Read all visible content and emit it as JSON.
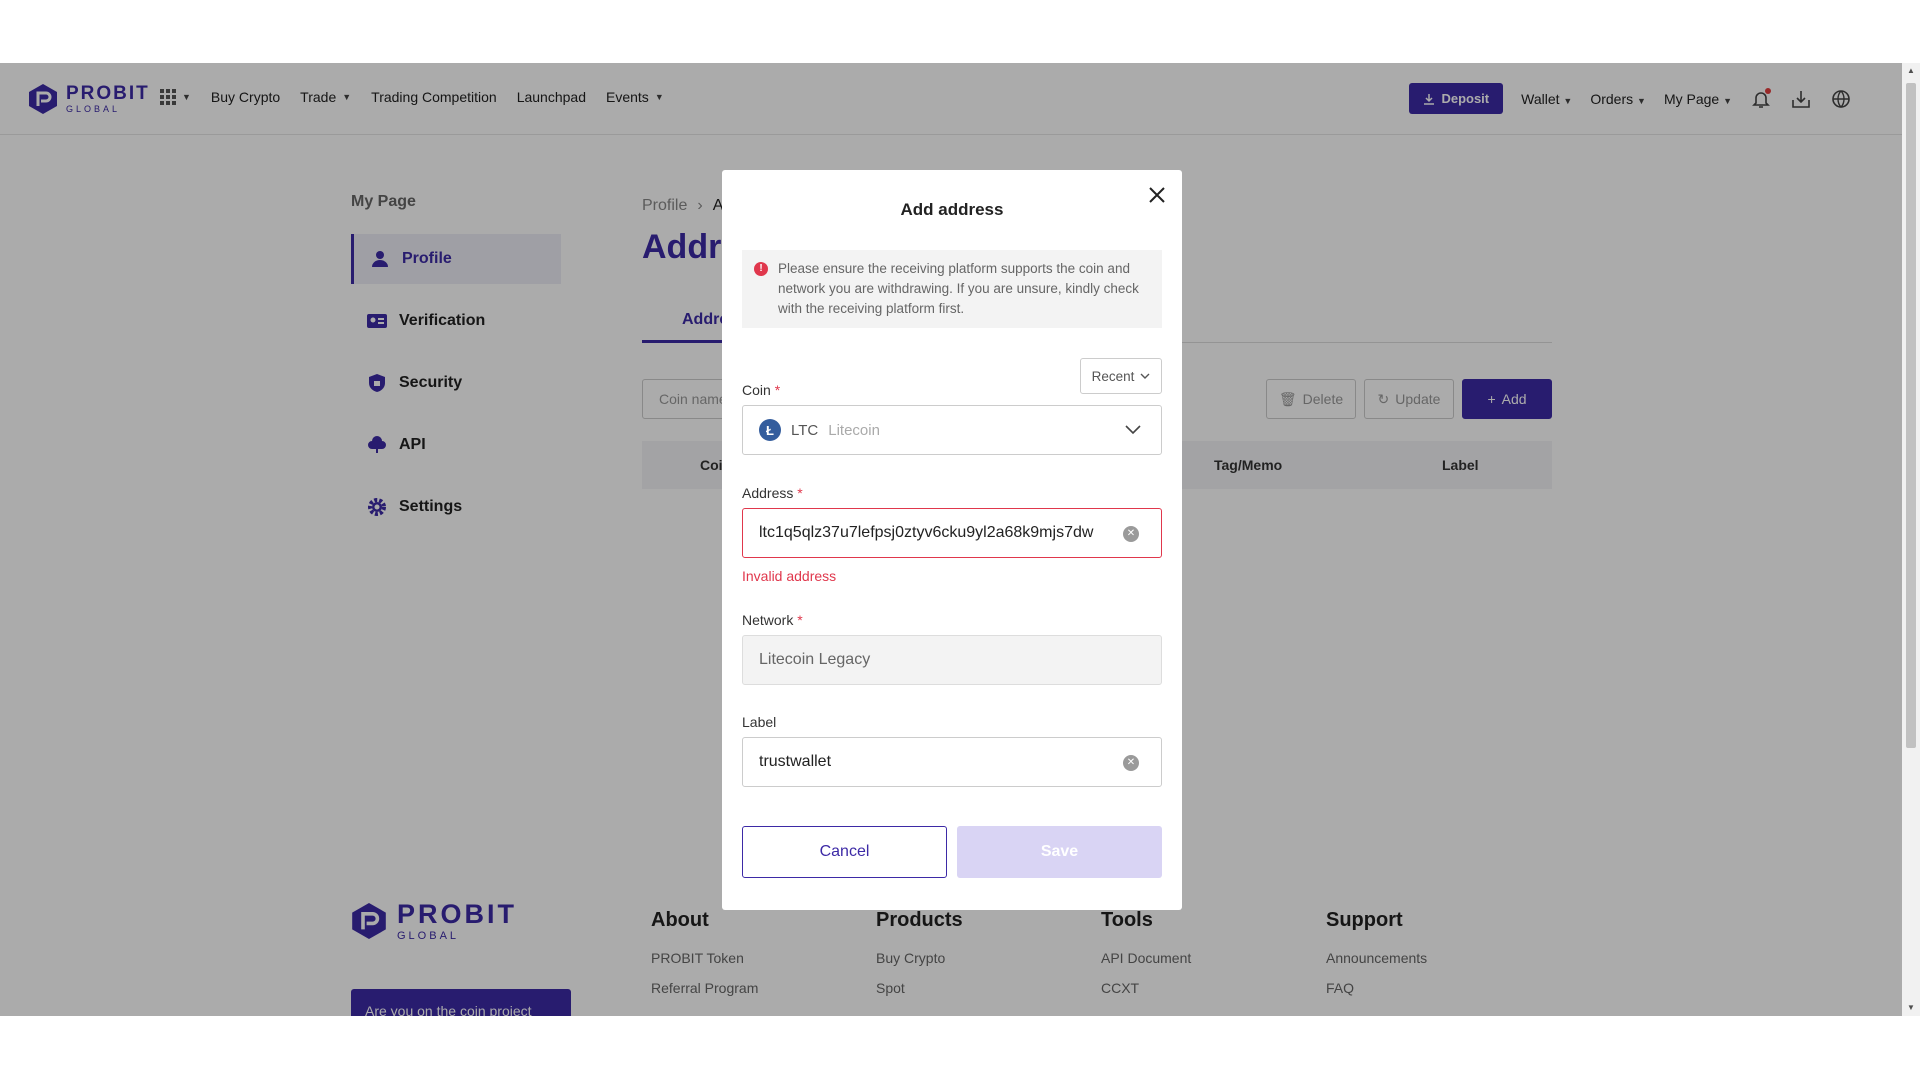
{
  "header": {
    "brand": "PROBIT",
    "brand_sub": "GLOBAL",
    "nav": [
      "Buy Crypto",
      "Trade",
      "Trading Competition",
      "Launchpad",
      "Events"
    ],
    "deposit_label": "Deposit",
    "right_nav": [
      "Wallet",
      "Orders",
      "My Page"
    ]
  },
  "sidebar": {
    "title": "My Page",
    "items": [
      {
        "label": "Profile",
        "icon": "user-icon"
      },
      {
        "label": "Verification",
        "icon": "id-card-icon"
      },
      {
        "label": "Security",
        "icon": "shield-icon"
      },
      {
        "label": "API",
        "icon": "cloud-icon"
      },
      {
        "label": "Settings",
        "icon": "gear-icon"
      }
    ]
  },
  "main": {
    "breadcrumb": [
      "Profile",
      "A"
    ],
    "title": "Addre",
    "tab_label": "Addre",
    "filter_placeholder": "Coin name",
    "actions": {
      "delete": "Delete",
      "update": "Update",
      "add": "Add"
    },
    "columns": [
      "Coi",
      "Tag/Memo",
      "Label"
    ]
  },
  "footer": {
    "brand": "PROBIT",
    "brand_sub": "GLOBAL",
    "cta": "Are you on the coin project",
    "cols": [
      {
        "title": "About",
        "links": [
          "PROBIT Token",
          "Referral Program"
        ]
      },
      {
        "title": "Products",
        "links": [
          "Buy Crypto",
          "Spot"
        ]
      },
      {
        "title": "Tools",
        "links": [
          "API Document",
          "CCXT"
        ]
      },
      {
        "title": "Support",
        "links": [
          "Announcements",
          "FAQ"
        ]
      }
    ]
  },
  "modal": {
    "title": "Add address",
    "warning": "Please ensure the receiving platform supports the coin and network you are withdrawing. If you are unsure, kindly check with the receiving platform first.",
    "recent_label": "Recent",
    "coin_label": "Coin",
    "coin_symbol": "LTC",
    "coin_name": "Litecoin",
    "address_label": "Address",
    "address_value": "ltc1q5qlz37u7lefpsj0ztyv6cku9yl2a68k9mjs7dw",
    "address_error": "Invalid address",
    "network_label": "Network",
    "network_value": "Litecoin Legacy",
    "label_label": "Label",
    "label_value": "trustwallet",
    "required_mark": "*",
    "cancel_label": "Cancel",
    "save_label": "Save"
  }
}
